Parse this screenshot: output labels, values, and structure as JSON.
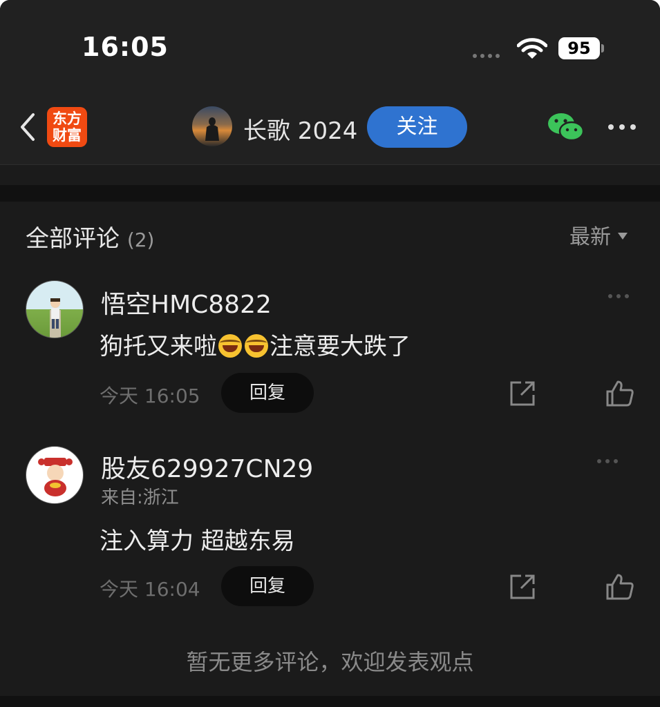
{
  "status_bar": {
    "time": "16:05",
    "battery": "95"
  },
  "header": {
    "app_logo_line1": "东方",
    "app_logo_line2": "财富",
    "author_name": "长歌 2024",
    "follow_label": "关注"
  },
  "comments_section": {
    "title": "全部评论",
    "count": "(2)",
    "sort_label": "最新"
  },
  "comments": [
    {
      "user": "悟空HMC8822",
      "text_before": "狗托又来啦",
      "text_after": "注意要大跌了",
      "time": "今天 16:05",
      "reply_label": "回复"
    },
    {
      "user": "股友629927CN29",
      "location": "来自:浙江",
      "text": "注入算力 超越东易",
      "time": "今天 16:04",
      "reply_label": "回复"
    }
  ],
  "footer_text": "暂无更多评论，欢迎发表观点",
  "colors": {
    "accent": "#2f73d0",
    "brand": "#f04a12",
    "background": "#1b1b1b"
  }
}
